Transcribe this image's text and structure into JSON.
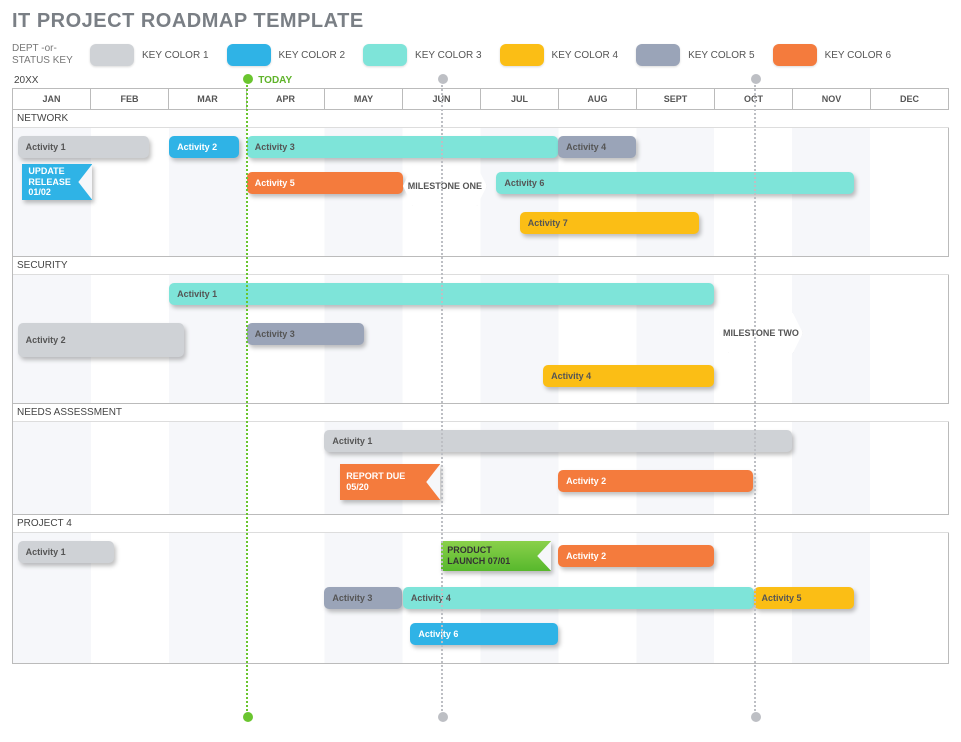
{
  "title": "IT PROJECT ROADMAP TEMPLATE",
  "legend": {
    "label_line1": "DEPT -or-",
    "label_line2": "STATUS KEY",
    "items": [
      {
        "label": "KEY COLOR 1",
        "color": "#cfd2d6"
      },
      {
        "label": "KEY COLOR 2",
        "color": "#2fb3e6"
      },
      {
        "label": "KEY COLOR 3",
        "color": "#7ee4d9"
      },
      {
        "label": "KEY COLOR 4",
        "color": "#fbbe15"
      },
      {
        "label": "KEY COLOR 5",
        "color": "#9aa4b8"
      },
      {
        "label": "KEY COLOR 6",
        "color": "#f47b3d"
      }
    ]
  },
  "year": "20XX",
  "today_label": "TODAY",
  "months": [
    "JAN",
    "FEB",
    "MAR",
    "APR",
    "MAY",
    "JUN",
    "JUL",
    "AUG",
    "SEPT",
    "OCT",
    "NOV",
    "DEC"
  ],
  "sections": {
    "network": {
      "title": "NETWORK",
      "activity1": "Activity 1",
      "activity2": "Activity 2",
      "activity3": "Activity 3",
      "activity4": "Activity 4",
      "activity5": "Activity 5",
      "activity6": "Activity 6",
      "activity7": "Activity 7",
      "update": "UPDATE\nRELEASE\n01/02",
      "ms1": "MILESTONE ONE"
    },
    "security": {
      "title": "SECURITY",
      "activity1": "Activity 1",
      "activity2": "Activity 2",
      "activity3": "Activity 3",
      "activity4": "Activity 4",
      "ms2": "MILESTONE TWO"
    },
    "needs": {
      "title": "NEEDS ASSESSMENT",
      "activity1": "Activity 1",
      "activity2": "Activity 2",
      "report": "REPORT DUE\n05/20"
    },
    "project4": {
      "title": "PROJECT 4",
      "activity1": "Activity 1",
      "activity2": "Activity 2",
      "activity3": "Activity 3",
      "activity4": "Activity 4",
      "activity5": "Activity 5",
      "activity6": "Activity 6",
      "launch": "PRODUCT\nLAUNCH 07/01"
    }
  },
  "chart_data": {
    "type": "gantt",
    "title": "IT PROJECT ROADMAP TEMPLATE",
    "year": "20XX",
    "x_axis_months": [
      "JAN",
      "FEB",
      "MAR",
      "APR",
      "MAY",
      "JUN",
      "JUL",
      "AUG",
      "SEPT",
      "OCT",
      "NOV",
      "DEC"
    ],
    "today_marker_month": 3.0,
    "vertical_markers_month": [
      5.5,
      9.5
    ],
    "color_key": {
      "KEY COLOR 1": "#cfd2d6",
      "KEY COLOR 2": "#2fb3e6",
      "KEY COLOR 3": "#7ee4d9",
      "KEY COLOR 4": "#fbbe15",
      "KEY COLOR 5": "#9aa4b8",
      "KEY COLOR 6": "#f47b3d"
    },
    "sections": [
      {
        "name": "NETWORK",
        "rows": [
          [
            {
              "type": "bar",
              "label": "Activity 1",
              "color": "KEY COLOR 1",
              "start": 0.0,
              "end": 1.8
            },
            {
              "type": "bar",
              "label": "Activity 2",
              "color": "KEY COLOR 2",
              "start": 2.0,
              "end": 2.9
            },
            {
              "type": "bar",
              "label": "Activity 3",
              "color": "KEY COLOR 3",
              "start": 3.0,
              "end": 7.0
            },
            {
              "type": "bar",
              "label": "Activity 4",
              "color": "KEY COLOR 5",
              "start": 7.0,
              "end": 8.0
            }
          ],
          [
            {
              "type": "flag",
              "label": "UPDATE RELEASE 01/02",
              "color": "KEY COLOR 2",
              "at": 0.1
            },
            {
              "type": "bar",
              "label": "Activity 5",
              "color": "KEY COLOR 6",
              "start": 3.0,
              "end": 5.0
            },
            {
              "type": "milestone",
              "label": "MILESTONE ONE",
              "at": 5.5
            },
            {
              "type": "bar",
              "label": "Activity 6",
              "color": "KEY COLOR 3",
              "start": 6.2,
              "end": 10.8
            }
          ],
          [
            {
              "type": "bar",
              "label": "Activity 7",
              "color": "KEY COLOR 4",
              "start": 6.5,
              "end": 8.8
            }
          ]
        ]
      },
      {
        "name": "SECURITY",
        "rows": [
          [
            {
              "type": "bar",
              "label": "Activity 1",
              "color": "KEY COLOR 3",
              "start": 2.0,
              "end": 9.0
            }
          ],
          [
            {
              "type": "bar",
              "label": "Activity 2",
              "color": "KEY COLOR 1",
              "start": 0.0,
              "end": 2.2
            },
            {
              "type": "bar",
              "label": "Activity 3",
              "color": "KEY COLOR 5",
              "start": 3.0,
              "end": 4.5
            },
            {
              "type": "milestone",
              "label": "MILESTONE TWO",
              "at": 9.5
            }
          ],
          [
            {
              "type": "bar",
              "label": "Activity 4",
              "color": "KEY COLOR 4",
              "start": 6.8,
              "end": 9.0
            }
          ]
        ]
      },
      {
        "name": "NEEDS ASSESSMENT",
        "rows": [
          [
            {
              "type": "bar",
              "label": "Activity 1",
              "color": "KEY COLOR 1",
              "start": 4.0,
              "end": 10.0
            }
          ],
          [
            {
              "type": "flag",
              "label": "REPORT DUE 05/20",
              "color": "KEY COLOR 6",
              "at": 4.2
            },
            {
              "type": "bar",
              "label": "Activity 2",
              "color": "KEY COLOR 6",
              "start": 7.0,
              "end": 9.5
            }
          ]
        ]
      },
      {
        "name": "PROJECT 4",
        "rows": [
          [
            {
              "type": "bar",
              "label": "Activity 1",
              "color": "KEY COLOR 1",
              "start": 0.0,
              "end": 1.3
            },
            {
              "type": "flag",
              "label": "PRODUCT LAUNCH 07/01",
              "color": "green",
              "at": 5.5
            },
            {
              "type": "bar",
              "label": "Activity 2",
              "color": "KEY COLOR 6",
              "start": 7.0,
              "end": 9.0
            }
          ],
          [
            {
              "type": "bar",
              "label": "Activity 3",
              "color": "KEY COLOR 5",
              "start": 4.0,
              "end": 5.0
            },
            {
              "type": "bar",
              "label": "Activity 4",
              "color": "KEY COLOR 3",
              "start": 5.0,
              "end": 9.5
            },
            {
              "type": "bar",
              "label": "Activity 5",
              "color": "KEY COLOR 4",
              "start": 9.5,
              "end": 10.8
            }
          ],
          [
            {
              "type": "bar",
              "label": "Activity 6",
              "color": "KEY COLOR 2",
              "start": 5.1,
              "end": 7.0
            }
          ]
        ]
      }
    ]
  }
}
